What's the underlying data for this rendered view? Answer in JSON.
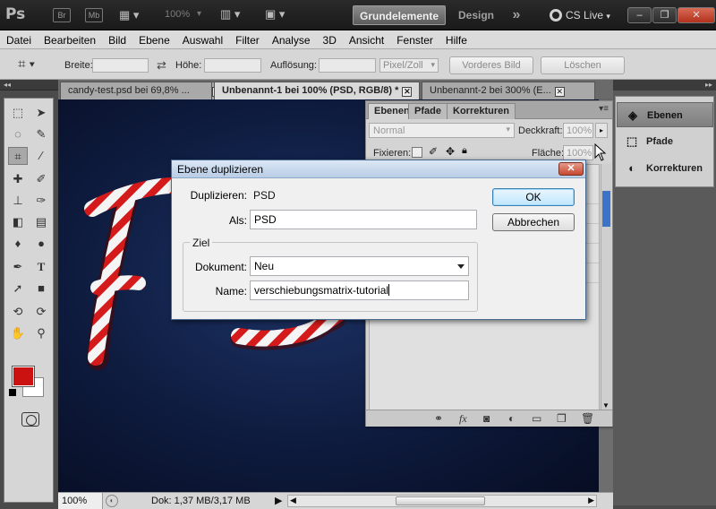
{
  "titlebar": {
    "logo": "Ps",
    "br": "Br",
    "mb": "Mb",
    "zoom": "100%",
    "workspace_active": "Grundelemente",
    "workspace_other": "Design",
    "more": "»",
    "cslive": "CS Live",
    "window_buttons": [
      "–",
      "❐",
      "✕"
    ]
  },
  "menu": [
    "Datei",
    "Bearbeiten",
    "Bild",
    "Ebene",
    "Auswahl",
    "Filter",
    "Analyse",
    "3D",
    "Ansicht",
    "Fenster",
    "Hilfe"
  ],
  "options": {
    "breite_label": "Breite:",
    "hoehe_label": "Höhe:",
    "aufloesung_label": "Auflösung:",
    "unit": "Pixel/Zoll",
    "vorderes_bild": "Vorderes Bild",
    "loeschen": "Löschen"
  },
  "doc_tabs": [
    {
      "label": "candy-test.psd bei 69,8% ..."
    },
    {
      "label": "Unbenannt-1 bei 100% (PSD, RGB/8) *"
    },
    {
      "label": "Unbenannt-2 bei 300% (E..."
    }
  ],
  "status": {
    "zoom": "100%",
    "doc_info": "Dok: 1,37 MB/3,17 MB"
  },
  "layers_panel": {
    "tabs": [
      "Ebenen",
      "Pfade",
      "Korrekturen"
    ],
    "blend_mode": "Normal",
    "deckkraft_label": "Deckkraft:",
    "deckkraft_value": "100%",
    "fixieren_label": "Fixieren:",
    "flaeche_label": "Fläche:",
    "flaeche_value": "100%"
  },
  "dock": {
    "items": [
      "Ebenen",
      "Pfade",
      "Korrekturen"
    ]
  },
  "dialog": {
    "title": "Ebene duplizieren",
    "duplizieren_label": "Duplizieren:",
    "duplizieren_value": "PSD",
    "als_label": "Als:",
    "als_value": "PSD",
    "group_label": "Ziel",
    "dokument_label": "Dokument:",
    "dokument_value": "Neu",
    "name_label": "Name:",
    "name_value": "verschiebungsmatrix-tutorial",
    "ok": "OK",
    "abbrechen": "Abbrechen"
  },
  "colors": {
    "foreground": "#cc1111",
    "background": "#ffffff",
    "canvas": "#0e1b3e"
  }
}
